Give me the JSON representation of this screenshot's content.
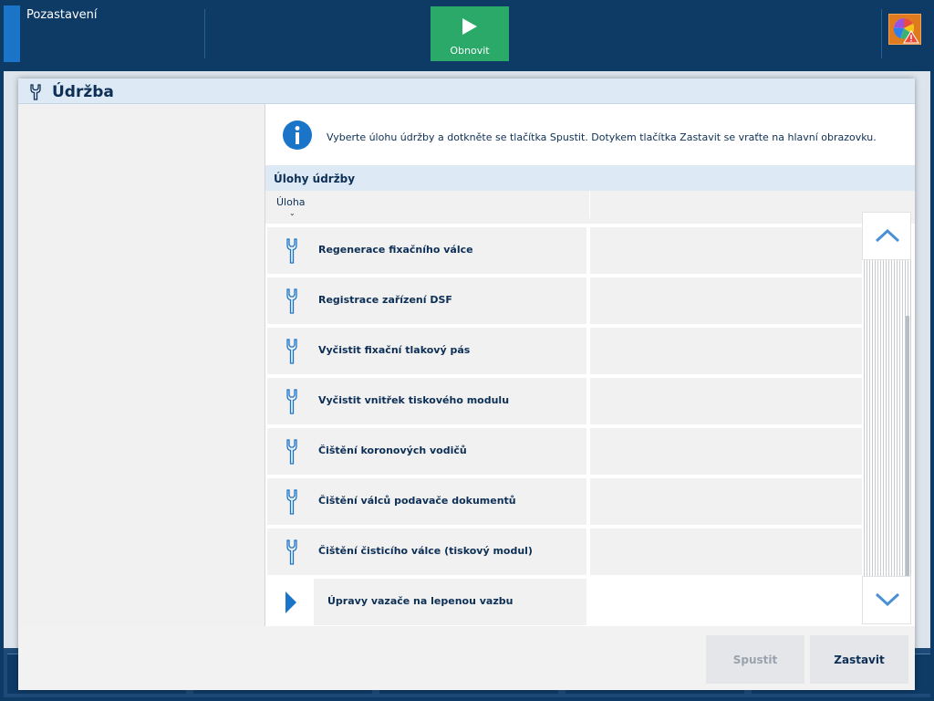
{
  "topbar": {
    "title": "Pozastavení",
    "refresh_label": "Obnovit",
    "status_icon": "warning-status-icon"
  },
  "modal": {
    "title": "Údržba",
    "info_text": "Vyberte úlohu údržby a dotkněte se tlačítka Spustit. Dotykem tlačítka Zastavit se vraťte na hlavní obrazovku.",
    "section_title": "Úlohy údržby",
    "column_task": "Úloha",
    "tasks": [
      {
        "label": "Regenerace fixačního válce",
        "icon": "wrench-icon"
      },
      {
        "label": "Registrace zařízení DSF",
        "icon": "wrench-icon"
      },
      {
        "label": "Vyčistit fixační tlakový pás",
        "icon": "wrench-icon"
      },
      {
        "label": "Vyčistit vnitřek tiskového modulu",
        "icon": "wrench-icon"
      },
      {
        "label": "Čištění koronových vodičů",
        "icon": "wrench-icon"
      },
      {
        "label": "Čištění válců podavače dokumentů",
        "icon": "wrench-icon"
      },
      {
        "label": "Čištění čisticího válce (tiskový modul)",
        "icon": "wrench-icon"
      },
      {
        "label": "Úpravy vazače na lepenou vazbu",
        "icon": "expand-arrow-icon"
      }
    ],
    "start_label": "Spustit",
    "stop_label": "Zastavit"
  },
  "colors": {
    "topbar": "#0e3a66",
    "accent": "#1a74c8",
    "refresh_green": "#2aa968",
    "text_dark": "#0d2f55",
    "header_blue": "#dde9f5",
    "status_orange": "#e07a1f"
  }
}
